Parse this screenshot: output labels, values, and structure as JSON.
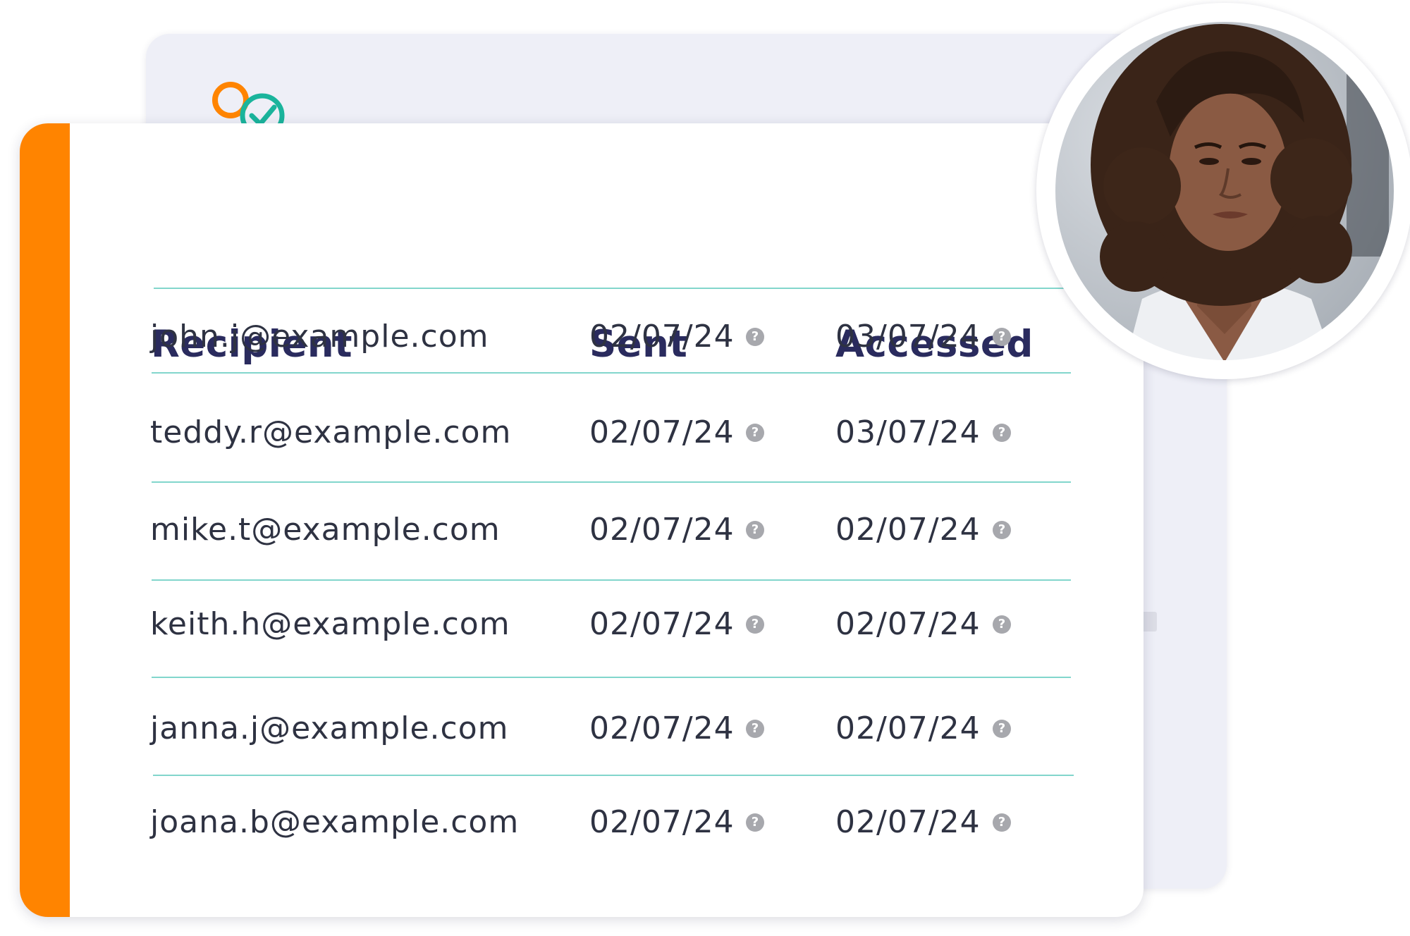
{
  "table": {
    "headers": {
      "recipient": "Recipient",
      "sent": "Sent",
      "accessed": "Accessed"
    },
    "rows": [
      {
        "recipient": "john.j@example.com",
        "sent": "02/07/24",
        "accessed": "03/07/24"
      },
      {
        "recipient": "teddy.r@example.com",
        "sent": "02/07/24",
        "accessed": "03/07/24"
      },
      {
        "recipient": "mike.t@example.com",
        "sent": "02/07/24",
        "accessed": "02/07/24"
      },
      {
        "recipient": "keith.h@example.com",
        "sent": "02/07/24",
        "accessed": "02/07/24"
      },
      {
        "recipient": "janna.j@example.com",
        "sent": "02/07/24",
        "accessed": "02/07/24"
      },
      {
        "recipient": "joana.b@example.com",
        "sent": "02/07/24",
        "accessed": "02/07/24"
      }
    ],
    "help_glyph": "?"
  },
  "colors": {
    "accent": "#ff8400",
    "heading": "#2a2b5e",
    "divider": "#82d6cc",
    "logo_teal": "#1ab49c"
  },
  "icons": {
    "help": "question-mark-circle-icon",
    "logo": "brand-logo-icon",
    "avatar": "user-photo"
  }
}
